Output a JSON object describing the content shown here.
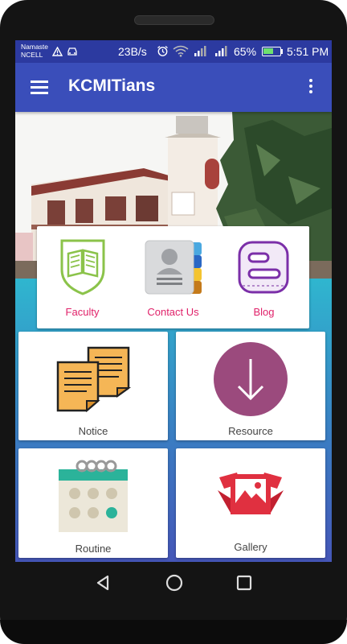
{
  "status_bar": {
    "carrier_line1": "Namaste",
    "carrier_line2": "NCELL",
    "net_speed": "23B/s",
    "battery_percent": "65%",
    "battery_level": 0.65,
    "time": "5:51 PM",
    "icons": [
      "warning-icon",
      "car-icon",
      "alarm-icon",
      "wifi-icon",
      "signal-icon",
      "signal-icon",
      "battery-icon"
    ]
  },
  "app_bar": {
    "title": "KCMITians",
    "menu_icon": "hamburger-menu-icon",
    "overflow_icon": "more-vert-icon"
  },
  "quick_links": [
    {
      "label": "Faculty",
      "icon": "book-shield-icon"
    },
    {
      "label": "Contact Us",
      "icon": "contact-book-icon"
    },
    {
      "label": "Blog",
      "icon": "blogger-icon"
    }
  ],
  "tiles": [
    {
      "label": "Notice",
      "icon": "sticky-notes-icon"
    },
    {
      "label": "Resource",
      "icon": "download-icon"
    },
    {
      "label": "Routine",
      "icon": "calendar-icon"
    },
    {
      "label": "Gallery",
      "icon": "photos-icon"
    }
  ],
  "colors": {
    "app_bar": "#3a4eba",
    "status_bar": "#2c3aa0",
    "quick_link_label": "#e0226a",
    "resource_circle": "#9b4a7d"
  },
  "nav_bar": {
    "back_icon": "back-triangle-icon",
    "home_icon": "home-circle-icon",
    "recents_icon": "recents-square-icon"
  }
}
